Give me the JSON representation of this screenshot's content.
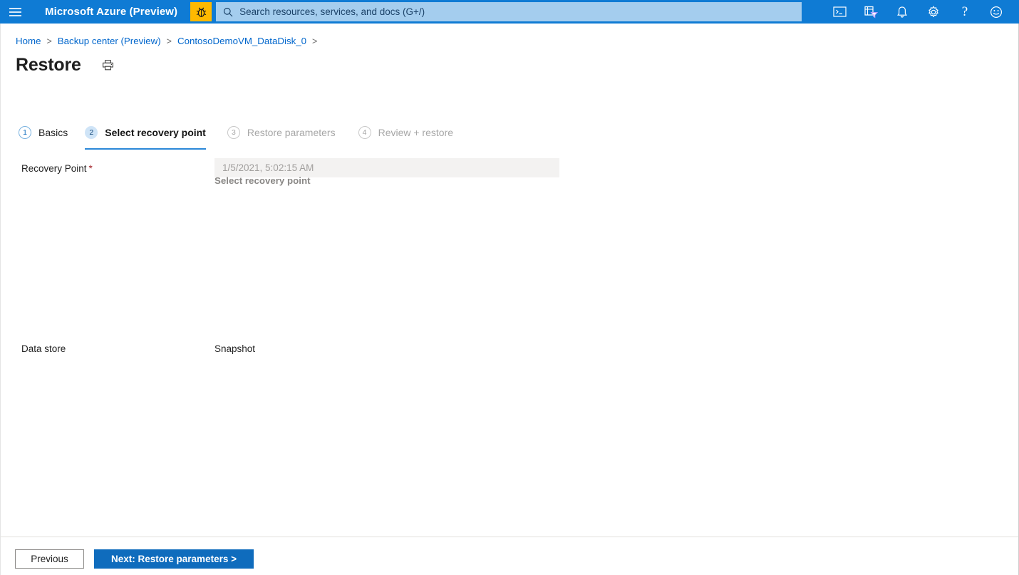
{
  "header": {
    "menu_icon": "hamburger-icon",
    "brand": "Microsoft Azure (Preview)",
    "preview_bug_icon": "bug-icon",
    "search": {
      "icon": "search-icon",
      "placeholder": "Search resources, services, and docs (G+/)",
      "value": ""
    },
    "icons": [
      {
        "name": "cloud-shell-icon",
        "title": "Cloud Shell"
      },
      {
        "name": "directory-filter-icon",
        "title": "Directories + subscriptions"
      },
      {
        "name": "notifications-bell-icon",
        "title": "Notifications"
      },
      {
        "name": "settings-gear-icon",
        "title": "Settings"
      },
      {
        "name": "help-question-icon",
        "title": "Help",
        "glyph": "?"
      },
      {
        "name": "feedback-smiley-icon",
        "title": "Feedback"
      }
    ],
    "colors": {
      "bar": "#0f7bd4",
      "search_bg": "#a4cdee",
      "bug_bg": "#ffb900"
    }
  },
  "breadcrumb": {
    "items": [
      {
        "label": "Home"
      },
      {
        "label": "Backup center (Preview)"
      },
      {
        "label": "ContosoDemoVM_DataDisk_0"
      }
    ],
    "separator": ">",
    "trailing_separator": ">"
  },
  "page": {
    "title": "Restore",
    "print_icon": "printer-icon"
  },
  "wizard": {
    "tabs": [
      {
        "num": "1",
        "label": "Basics",
        "state": "complete"
      },
      {
        "num": "2",
        "label": "Select recovery point",
        "state": "active"
      },
      {
        "num": "3",
        "label": "Restore parameters",
        "state": "disabled"
      },
      {
        "num": "4",
        "label": "Review + restore",
        "state": "disabled"
      }
    ],
    "accent_color": "#2b88d8"
  },
  "form": {
    "recovery_point": {
      "label": "Recovery Point",
      "required_marker": "*",
      "value": "1/5/2021, 5:02:15 AM",
      "link_label": "Select recovery point"
    },
    "data_store": {
      "label": "Data store",
      "value": "Snapshot"
    }
  },
  "footer": {
    "previous_label": "Previous",
    "next_label": "Next: Restore parameters >",
    "next_color": "#0f6cbd"
  }
}
